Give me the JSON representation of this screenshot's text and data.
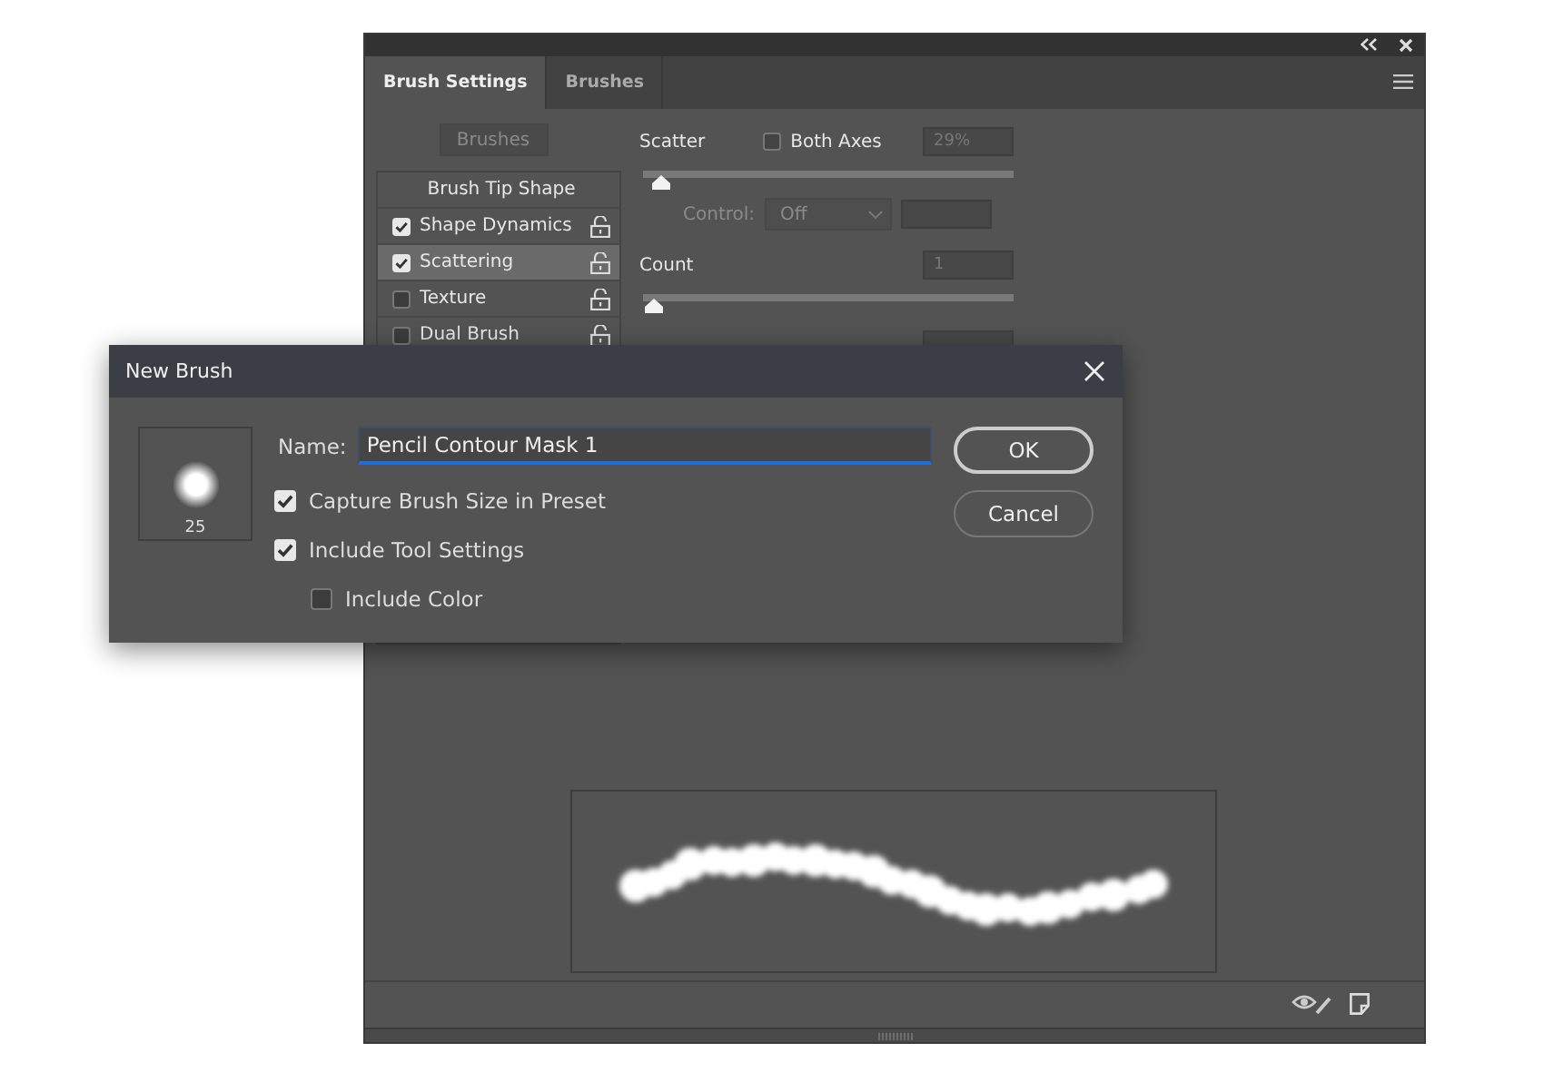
{
  "panel": {
    "tabs": [
      {
        "label": "Brush Settings",
        "selected": true
      },
      {
        "label": "Brushes",
        "selected": false
      }
    ],
    "brushes_button": "Brushes",
    "options": [
      {
        "label": "Brush Tip Shape",
        "kind": "header",
        "selected": false
      },
      {
        "label": "Shape Dynamics",
        "kind": "toggle",
        "checked": true,
        "selected": false
      },
      {
        "label": "Scattering",
        "kind": "toggle",
        "checked": true,
        "selected": true
      },
      {
        "label": "Texture",
        "kind": "toggle",
        "checked": false,
        "selected": false
      },
      {
        "label": "Dual Brush",
        "kind": "toggle",
        "checked": false,
        "selected": false
      }
    ],
    "scatter": {
      "label": "Scatter",
      "both_axes": {
        "label": "Both Axes",
        "checked": false
      },
      "value": "29%",
      "level": 0.02
    },
    "control": {
      "label": "Control:",
      "value": "Off",
      "disabled": true
    },
    "count": {
      "label": "Count",
      "value": "1",
      "level": 0
    }
  },
  "dialog": {
    "title": "New Brush",
    "preview_size": "25",
    "name_label": "Name:",
    "name_value": "Pencil Contour Mask 1",
    "options": [
      {
        "label": "Capture Brush Size in Preset",
        "kind": "option",
        "checked": true
      },
      {
        "label": "Include Tool Settings",
        "kind": "option",
        "checked": true
      },
      {
        "label": "Include Color",
        "kind": "sub_option",
        "checked": false
      }
    ],
    "buttons": [
      "OK",
      "Cancel"
    ]
  }
}
